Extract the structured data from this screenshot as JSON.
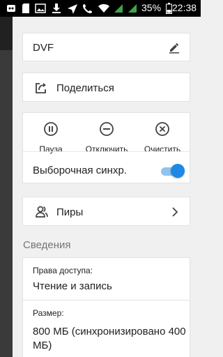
{
  "status_bar": {
    "battery_percent": "35%",
    "time": "22:38"
  },
  "panel": {
    "folder_name": "DVF",
    "share_label": "Поделиться",
    "actions": [
      {
        "label": "Пауза",
        "icon": "pause-circle-icon"
      },
      {
        "label": "Отключить",
        "icon": "minus-circle-icon"
      },
      {
        "label": "Очистить",
        "icon": "x-circle-icon"
      }
    ],
    "selective_sync_label": "Выборочная синхр.",
    "selective_sync_enabled": true,
    "peers_label": "Пиры",
    "details_header": "Сведения",
    "access_label": "Права доступа:",
    "access_value": "Чтение и запись",
    "size_label": "Размер:",
    "size_value": "800 МБ (синхронизировано 400 МБ)"
  },
  "colors": {
    "accent": "#1e88e5",
    "accent_track": "#90c4ee",
    "panel_bg": "#f0f0f0",
    "card_bg": "#ffffff"
  }
}
